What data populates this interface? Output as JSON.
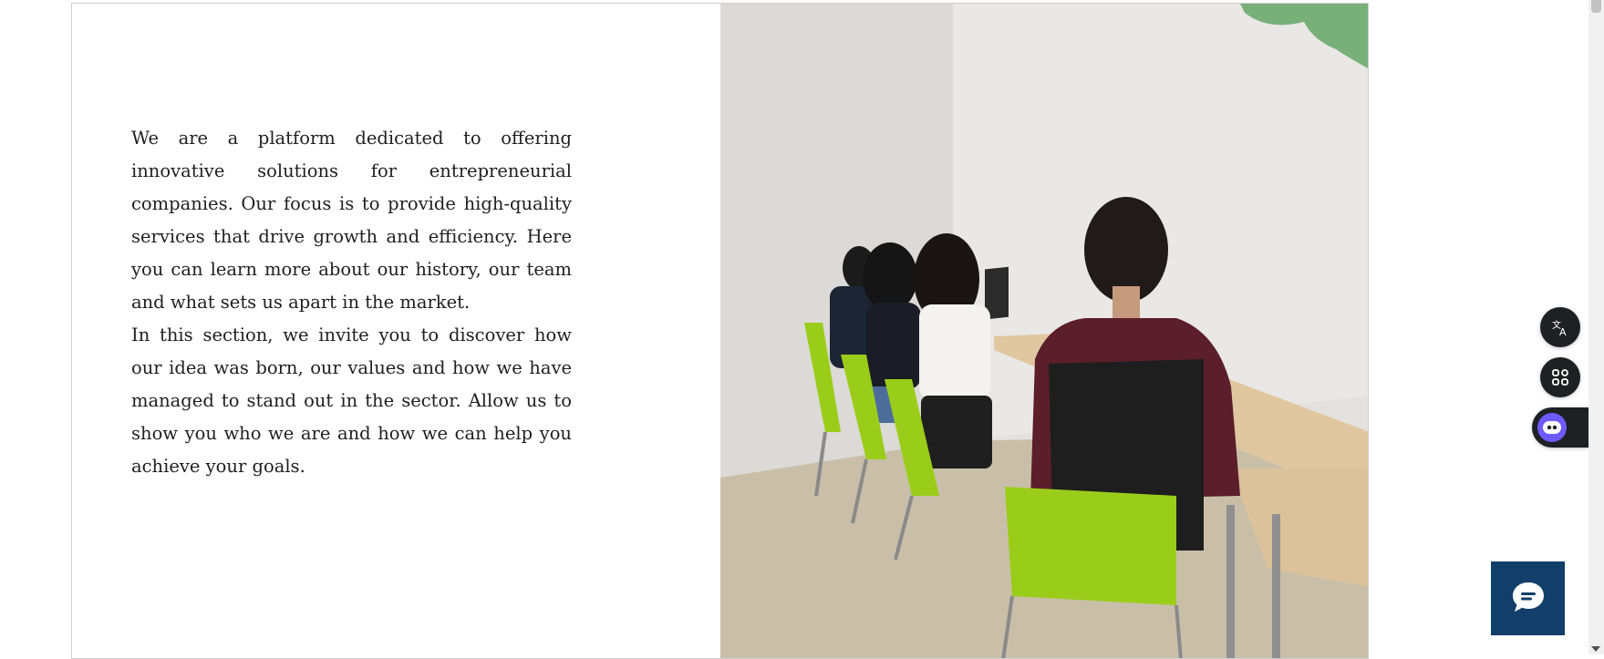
{
  "about": {
    "paragraph_1": "We are a platform dedicated to offering innovative solutions for entrepreneurial companies. Our focus is to provide high-quality services that drive growth and efficiency. Here you can learn more about our history, our team and what sets us apart in the market.",
    "paragraph_2": "In this section, we invite you to discover how our idea was born, our values and how we have managed to stand out in the sector. Allow us to show you who we are and how we can help you achieve your goals."
  },
  "photo": {
    "subject": "students working on laptops at a shared desk",
    "chair_color": "#9acd1a",
    "wall_color": "#e6e4e1"
  },
  "floating_tools": {
    "translate_icon": "translate-icon",
    "apps_icon": "apps-grid-icon",
    "assistant_icon": "assistant-bot-icon"
  },
  "chat": {
    "icon": "chat-bubble-icon",
    "color": "#113f6a"
  }
}
